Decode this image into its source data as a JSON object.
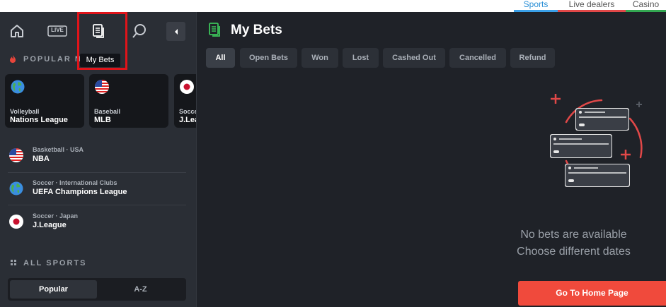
{
  "top_tabs": {
    "sports": "Sports",
    "live_dealers": "Live dealers",
    "casino": "Casino"
  },
  "nav": {
    "home_icon": "home-icon",
    "live_label": "LIVE",
    "mybets_icon": "document-icon",
    "search_icon": "search-icon",
    "collapse_icon": "chevron-left-icon",
    "tooltip": "My Bets"
  },
  "sidebar": {
    "popular_label": "POPULAR NO",
    "cards": [
      {
        "sport": "Volleyball",
        "league": "Nations League",
        "flag": "globe"
      },
      {
        "sport": "Baseball",
        "league": "MLB",
        "flag": "usa"
      },
      {
        "sport": "Soccer",
        "league": "J.Lea",
        "flag": "japan"
      }
    ],
    "list": [
      {
        "meta": "Basketball · USA",
        "name": "NBA",
        "flag": "usa"
      },
      {
        "meta": "Soccer · International Clubs",
        "name": "UEFA Champions League",
        "flag": "globe"
      },
      {
        "meta": "Soccer · Japan",
        "name": "J.League",
        "flag": "japan"
      }
    ],
    "all_sports_label": "ALL SPORTS",
    "sort": {
      "popular": "Popular",
      "az": "A-Z"
    }
  },
  "main": {
    "title": "My Bets",
    "filters": [
      "All",
      "Open Bets",
      "Won",
      "Lost",
      "Cashed Out",
      "Cancelled",
      "Refund"
    ],
    "active_filter": "All",
    "empty_line_1": "No bets are available",
    "empty_line_2": "Choose different dates",
    "home_button": "Go To Home Page"
  },
  "colors": {
    "accent_red": "#f04a3c",
    "sports_blue": "#3aa0e8",
    "live_red": "#e14848",
    "casino_green": "#33a852",
    "mybets_green": "#3cc45a"
  }
}
